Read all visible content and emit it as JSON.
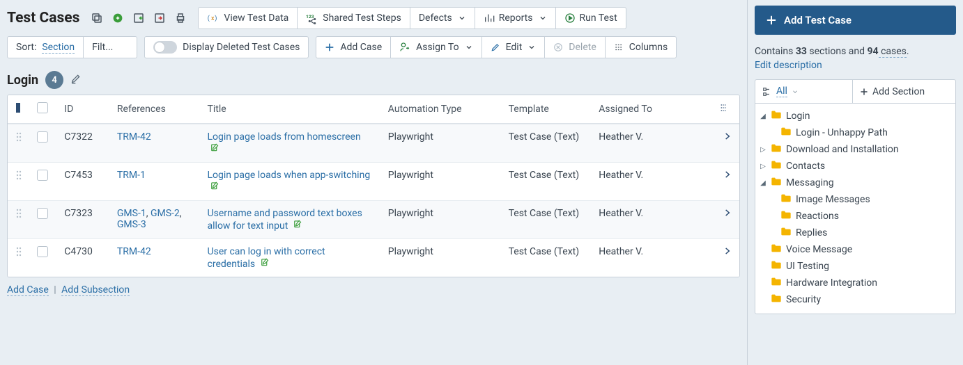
{
  "title": "Test Cases",
  "header_buttons": {
    "view_test_data": "View Test Data",
    "shared_test_steps": "Shared Test Steps",
    "defects": "Defects",
    "reports": "Reports",
    "run_test": "Run Test"
  },
  "toolbar": {
    "sort_label": "Sort:",
    "sort_value": "Section",
    "filter_label": "Filt...",
    "deleted_label": "Display Deleted Test Cases",
    "add_case": "Add Case",
    "assign_to": "Assign To",
    "edit": "Edit",
    "delete": "Delete",
    "columns": "Columns"
  },
  "section": {
    "name": "Login",
    "count": "4"
  },
  "columns": {
    "id": "ID",
    "references": "References",
    "title": "Title",
    "automation_type": "Automation Type",
    "template": "Template",
    "assigned_to": "Assigned To"
  },
  "rows": [
    {
      "id": "C7322",
      "refs": [
        "TRM-42"
      ],
      "title": "Login page loads from homescreen",
      "automation": "Playwright",
      "template": "Test Case (Text)",
      "assigned": "Heather V."
    },
    {
      "id": "C7453",
      "refs": [
        "TRM-1"
      ],
      "title": "Login page loads when app-switching",
      "automation": "Playwright",
      "template": "Test Case (Text)",
      "assigned": "Heather V."
    },
    {
      "id": "C7323",
      "refs": [
        "GMS-1",
        "GMS-2",
        "GMS-3"
      ],
      "title": "Username and password text boxes allow for text input",
      "automation": "Playwright",
      "template": "Test Case (Text)",
      "assigned": "Heather V."
    },
    {
      "id": "C4730",
      "refs": [
        "TRM-42"
      ],
      "title": "User can log in with correct credentials",
      "automation": "Playwright",
      "template": "Test Case (Text)",
      "assigned": "Heather V."
    }
  ],
  "footer": {
    "add_case": "Add Case",
    "add_subsection": "Add Subsection"
  },
  "sidebar": {
    "add_test_case": "Add Test Case",
    "summary_prefix": "Contains ",
    "sections_count": "33",
    "sections_word": " sections and ",
    "cases_count": "94",
    "cases_word": " cases",
    "summary_suffix": ".",
    "edit_description": "Edit description",
    "all": "All",
    "add_section": "Add Section",
    "tree": [
      {
        "label": "Login",
        "expander": "open",
        "children": [
          {
            "label": "Login - Unhappy Path"
          }
        ]
      },
      {
        "label": "Download and Installation",
        "expander": "closed"
      },
      {
        "label": "Contacts",
        "expander": "closed"
      },
      {
        "label": "Messaging",
        "expander": "open",
        "children": [
          {
            "label": "Image Messages"
          },
          {
            "label": "Reactions"
          },
          {
            "label": "Replies"
          }
        ]
      },
      {
        "label": "Voice Message"
      },
      {
        "label": "UI Testing"
      },
      {
        "label": "Hardware Integration"
      },
      {
        "label": "Security"
      }
    ]
  }
}
